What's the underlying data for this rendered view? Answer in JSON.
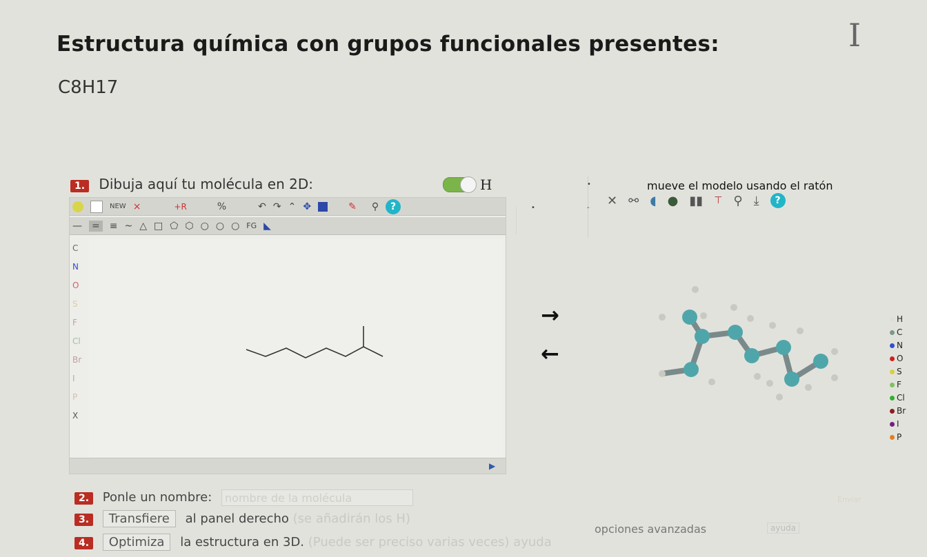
{
  "page": {
    "title": "Estructura química con grupos funcionales presentes:",
    "cursor_glyph": "I",
    "formula": "C8H17"
  },
  "steps": {
    "step1": {
      "number": "1.",
      "label": "Dibuja aquí tu molécula en 2D:"
    },
    "step2": {
      "number": "2.",
      "label": "Ponle un nombre:",
      "input_placeholder": "nombre de la molécula"
    },
    "step3": {
      "number": "3.",
      "button": "Transfiere",
      "label": "al panel derecho",
      "hint": "(se añadirán los H)"
    },
    "step4": {
      "number": "4.",
      "button": "Optimiza",
      "label": "la estructura en 3D.",
      "hint": "(Puede ser preciso varias veces)",
      "help": "ayuda"
    }
  },
  "h_toggle": {
    "label": "H",
    "state": "on"
  },
  "editor": {
    "toolbar1": [
      "NEW",
      "×",
      "+R",
      "%"
    ],
    "toolbar2": [
      "—",
      "=",
      "≡",
      "~",
      "△",
      "□",
      "⬠",
      "⬡",
      "○",
      "○",
      "○",
      "FG"
    ],
    "atoms": [
      "C",
      "N",
      "O",
      "S",
      "F",
      "Cl",
      "Br",
      "I",
      "P",
      "X"
    ]
  },
  "viewer": {
    "label": "mueve el modelo usando el ratón",
    "legend": [
      {
        "symbol": "H",
        "color": "#dddddd"
      },
      {
        "symbol": "C",
        "color": "#7a9a8a"
      },
      {
        "symbol": "N",
        "color": "#3050d0"
      },
      {
        "symbol": "O",
        "color": "#d02020"
      },
      {
        "symbol": "S",
        "color": "#d8d040"
      },
      {
        "symbol": "F",
        "color": "#80c060"
      },
      {
        "symbol": "Cl",
        "color": "#30b030"
      },
      {
        "symbol": "Br",
        "color": "#8a2020"
      },
      {
        "symbol": "I",
        "color": "#702080"
      },
      {
        "symbol": "P",
        "color": "#e08020"
      }
    ]
  },
  "advanced": {
    "label": "opciones avanzadas",
    "help": "ayuda"
  },
  "send_label": "Enviar",
  "colors": {
    "badge": "#b92d22",
    "accent_teal": "#22b5c8",
    "toggle_on": "#7bb54a"
  }
}
